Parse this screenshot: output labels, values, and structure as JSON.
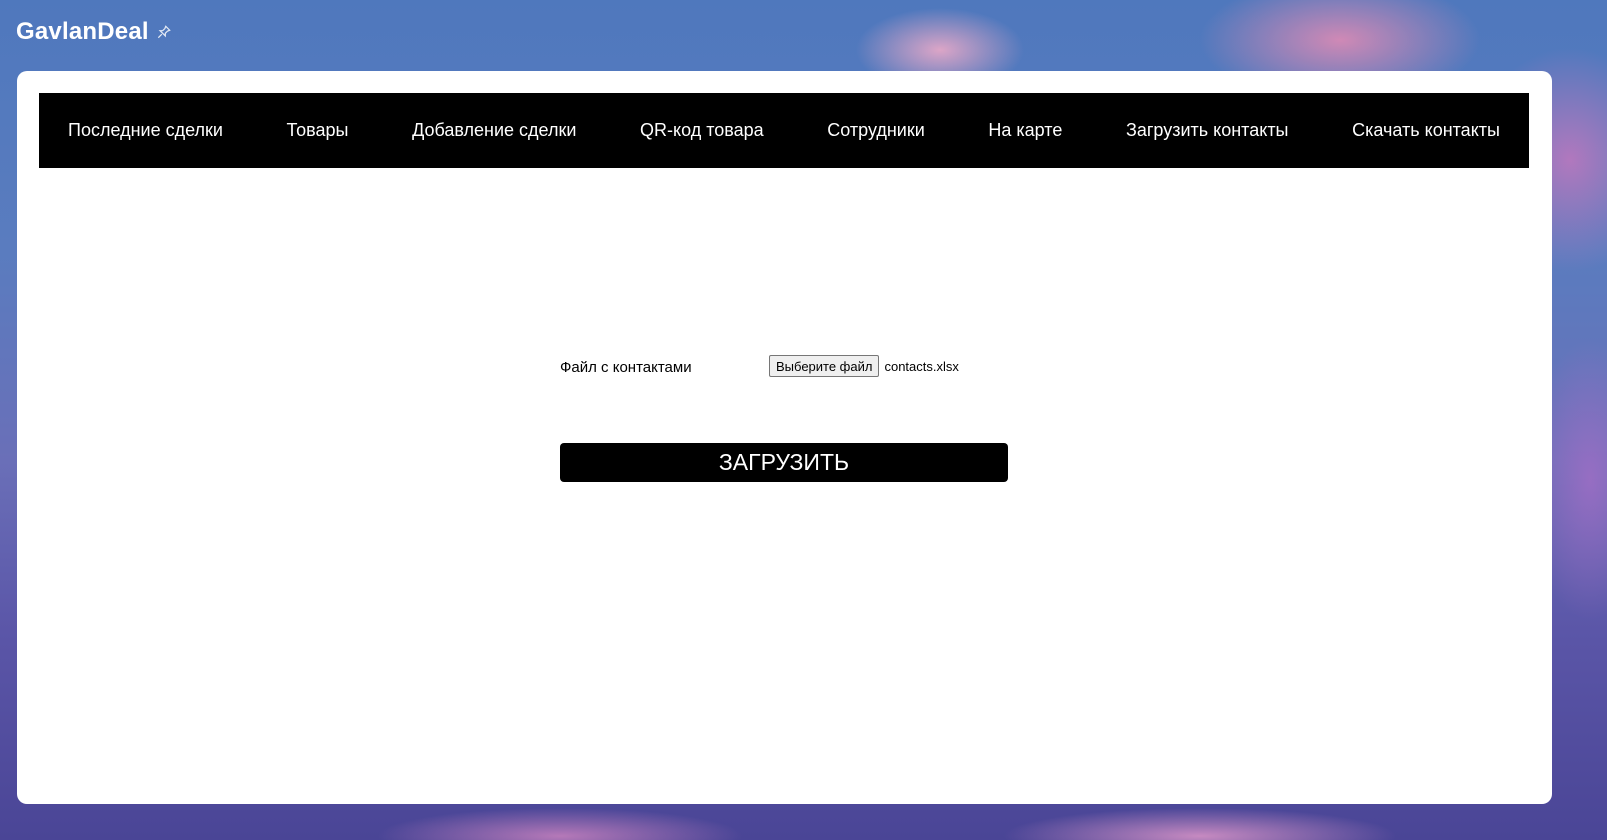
{
  "app": {
    "title": "GavlanDeal",
    "title_icon": "pin-icon"
  },
  "nav": {
    "items": [
      {
        "label": "Последние сделки"
      },
      {
        "label": "Товары"
      },
      {
        "label": "Добавление сделки"
      },
      {
        "label": "QR-код товара"
      },
      {
        "label": "Сотрудники"
      },
      {
        "label": "На карте"
      },
      {
        "label": "Загрузить контакты"
      },
      {
        "label": "Скачать контакты"
      }
    ]
  },
  "form": {
    "file_label": "Файл с контактами",
    "file_button": "Выберите файл",
    "file_name": "contacts.xlsx",
    "submit_label": "ЗАГРУЗИТЬ"
  },
  "colors": {
    "navbar_bg": "#000000",
    "nav_text": "#ffffff",
    "button_bg": "#000000",
    "panel_bg": "#ffffff"
  }
}
